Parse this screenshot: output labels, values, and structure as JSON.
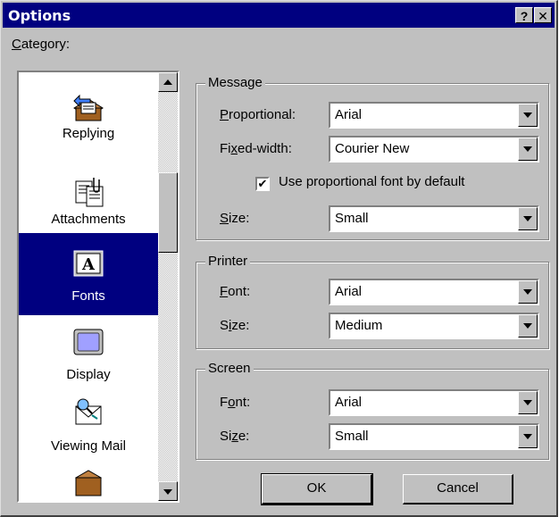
{
  "window": {
    "title": "Options",
    "help_button": "?",
    "close_button": "✕"
  },
  "category": {
    "label": "Category:",
    "items": [
      {
        "label": "Replying",
        "icon": "replying-icon"
      },
      {
        "label": "Attachments",
        "icon": "attachments-icon"
      },
      {
        "label": "Fonts",
        "icon": "fonts-icon",
        "selected": true
      },
      {
        "label": "Display",
        "icon": "display-icon"
      },
      {
        "label": "Viewing Mail",
        "icon": "viewing-mail-icon"
      }
    ]
  },
  "message": {
    "legend": "Message",
    "proportional_label": "Proportional:",
    "proportional_value": "Arial",
    "fixed_label": "Fixed-width:",
    "fixed_value": "Courier New",
    "checkbox_label": "Use proportional font by default",
    "checkbox_checked": true,
    "size_label": "Size:",
    "size_value": "Small"
  },
  "printer": {
    "legend": "Printer",
    "font_label": "Font:",
    "font_value": "Arial",
    "size_label": "Size:",
    "size_value": "Medium"
  },
  "screen": {
    "legend": "Screen",
    "font_label": "Font:",
    "font_value": "Arial",
    "size_label": "Size:",
    "size_value": "Small"
  },
  "buttons": {
    "ok": "OK",
    "cancel": "Cancel"
  },
  "colors": {
    "titlebar": "#000080",
    "face": "#c0c0c0",
    "selection": "#000080"
  }
}
